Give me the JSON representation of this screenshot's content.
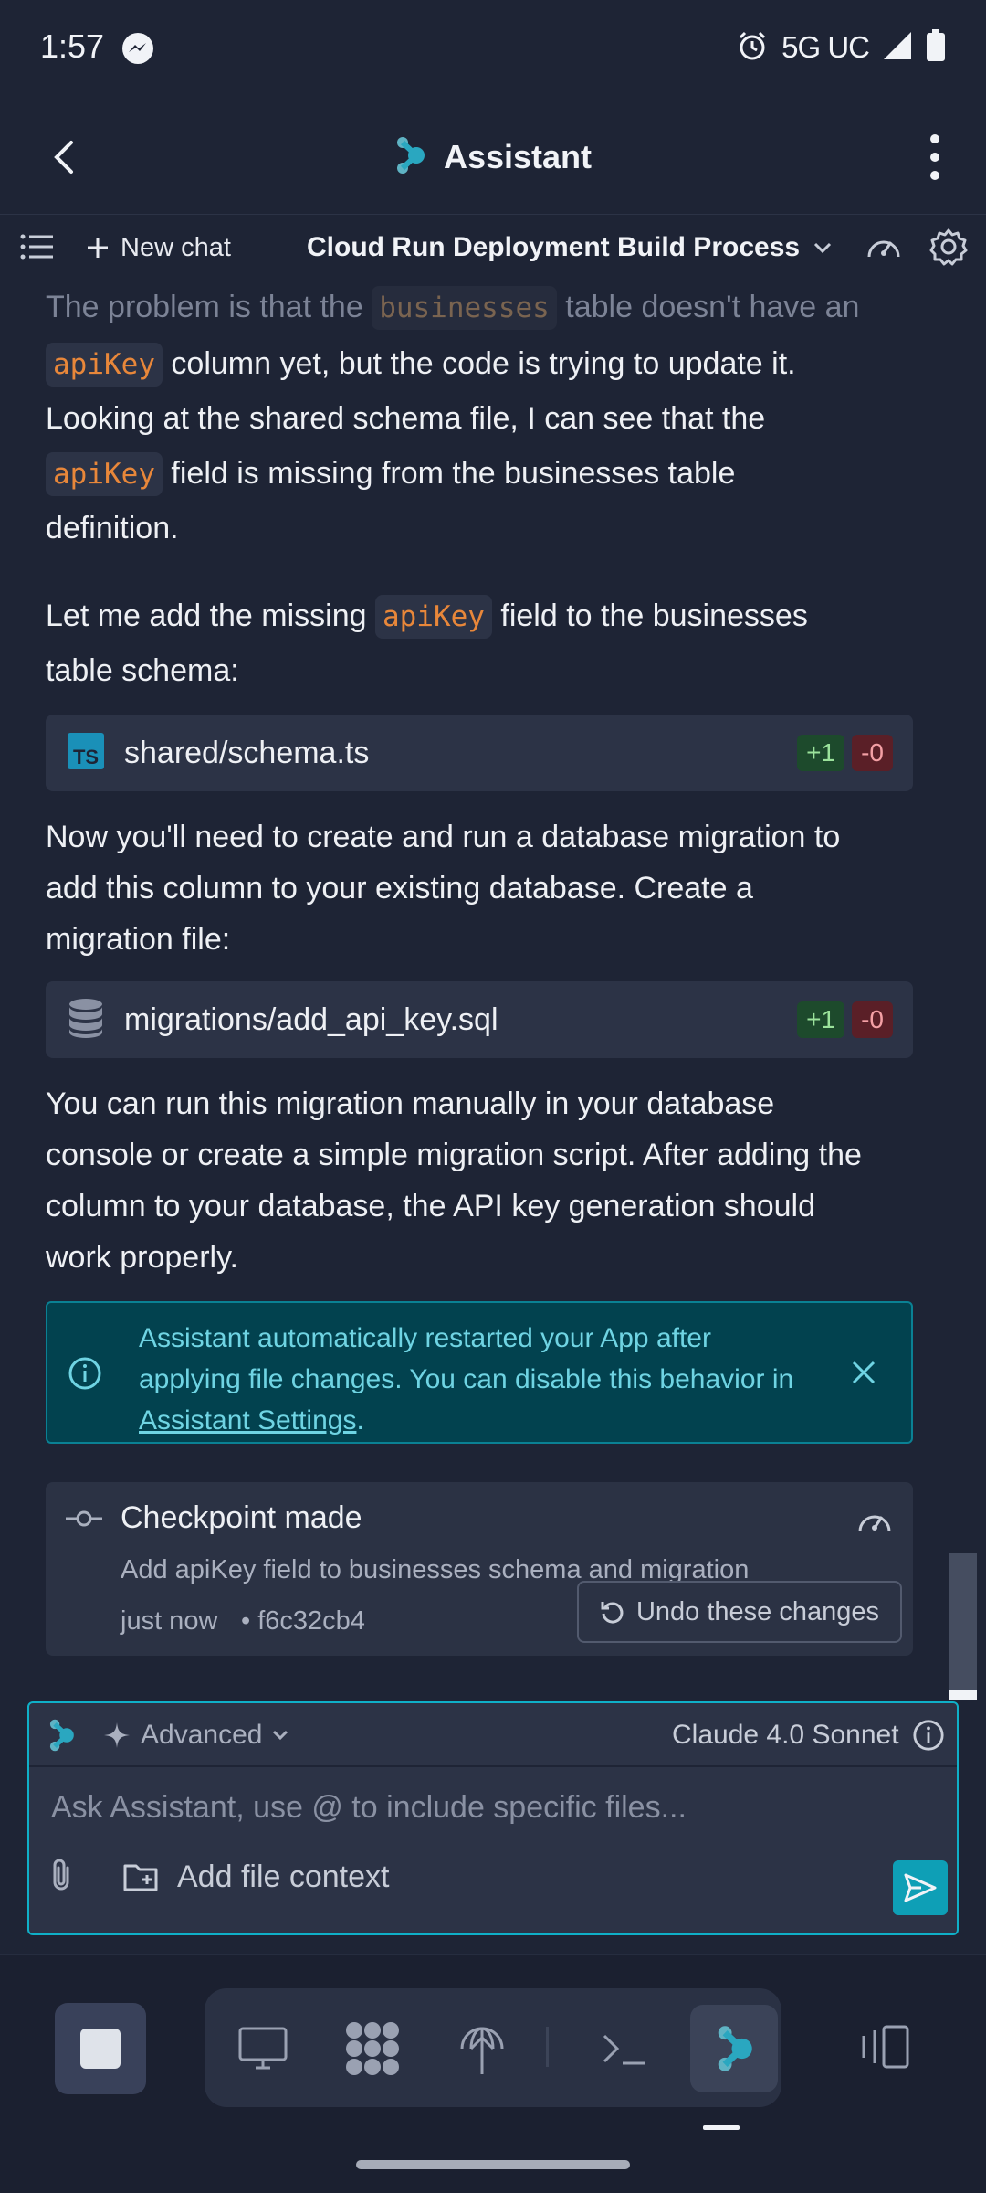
{
  "status_bar": {
    "time": "1:57",
    "network": "5G UC"
  },
  "app_bar": {
    "title": "Assistant"
  },
  "chat_toolbar": {
    "new_chat_label": "New chat",
    "chat_title": "Cloud Run Deployment Build Process"
  },
  "messages": {
    "p1_a": "The problem is that the ",
    "p1_code1": "businesses",
    "p1_b": " table doesn't have an",
    "p2_code": "apiKey",
    "p2_a": " column yet, but the code is trying to update it.",
    "p3": "Looking at the shared schema file, I can see that the",
    "p4_code": "apiKey",
    "p4_a": " field is missing from the businesses table",
    "p5": "definition.",
    "p6_a": "Let me add the missing ",
    "p6_code": "apiKey",
    "p6_b": " field to the businesses",
    "p7": "table schema:",
    "p8": "Now you'll need to create and run a database migration to",
    "p9": "add this column to your existing database. Create a",
    "p10": "migration file:",
    "p11": "You can run this migration manually in your database",
    "p12": "console or create a simple migration script. After adding the",
    "p13": "column to your database, the API key generation should",
    "p14": "work properly."
  },
  "files": [
    {
      "name": "shared/schema.ts",
      "added": "+1",
      "removed": "-0",
      "icon": "typescript-icon",
      "icon_text": "TS"
    },
    {
      "name": "migrations/add_api_key.sql",
      "added": "+1",
      "removed": "-0",
      "icon": "database-icon"
    }
  ],
  "info_banner": {
    "line1": "Assistant automatically restarted your App after",
    "line2": "applying file changes. You can disable this behavior in",
    "link": "Assistant Settings",
    "after": "."
  },
  "checkpoint": {
    "title": "Checkpoint made",
    "description": "Add apiKey field to businesses schema and migration",
    "time": "just now",
    "hash": "• f6c32cb4",
    "undo_label": "Undo these changes"
  },
  "input": {
    "mode": "Advanced",
    "model": "Claude 4.0 Sonnet",
    "placeholder": "Ask Assistant, use @ to include specific files...",
    "add_context_label": "Add file context"
  },
  "colors": {
    "background": "#1e2435",
    "accent": "#0fb0c8",
    "code_text": "#e8873a",
    "diff_add": "#1d4a2c",
    "diff_del": "#5a1f27",
    "info_bg": "#02424f"
  }
}
